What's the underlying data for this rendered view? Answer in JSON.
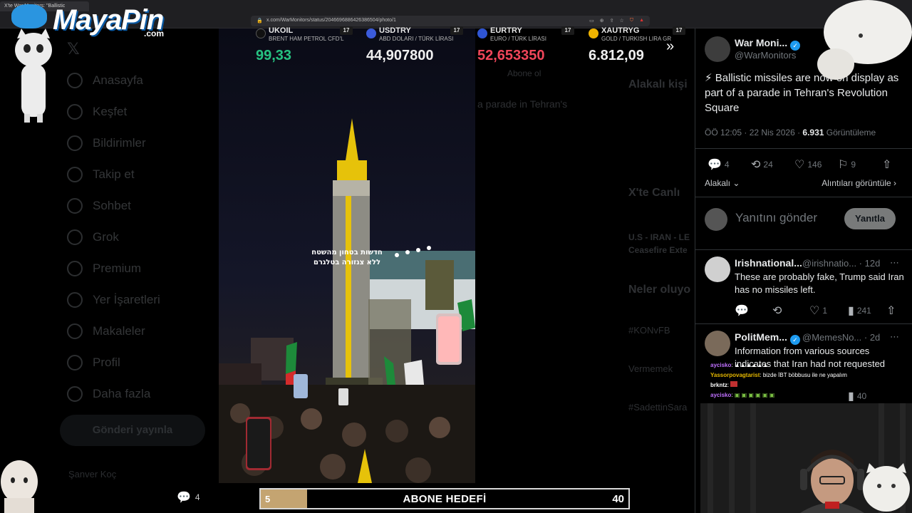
{
  "browser": {
    "tab_title": "X'te War Monitors: \"Ballistic",
    "url": "x.com/WarMonitors/status/2046696886426386504/photo/1"
  },
  "logo": {
    "text": "MayaPin",
    "suffix": ".com"
  },
  "sidebar": {
    "items": [
      {
        "label": "Anasayfa",
        "icon": "home-icon"
      },
      {
        "label": "Keşfet",
        "icon": "search-icon"
      },
      {
        "label": "Bildirimler",
        "icon": "bell-icon"
      },
      {
        "label": "Takip et",
        "icon": "person-plus-icon"
      },
      {
        "label": "Sohbet",
        "icon": "chat-icon"
      },
      {
        "label": "Grok",
        "icon": "grok-icon"
      },
      {
        "label": "Premium",
        "icon": "premium-icon"
      },
      {
        "label": "Yer İşaretleri",
        "icon": "bookmark-icon"
      },
      {
        "label": "Makaleler",
        "icon": "article-icon"
      },
      {
        "label": "Profil",
        "icon": "profile-icon"
      },
      {
        "label": "Daha fazla",
        "icon": "more-icon"
      }
    ],
    "post_button": "Gönderi yayınla",
    "profile_name": "Şanver Koç"
  },
  "background": {
    "subscribe": "Abone ol",
    "related_accounts": "Alakalı kişi",
    "caption": "a parade in Tehran's",
    "live_on_x": "X'te Canlı",
    "live_item": "U.S - IRAN - LE",
    "live_item2": "Ceasefire Exte",
    "whats_happening": "Neler oluyo",
    "trend1": "#KONvFB",
    "trend2": "Vermemek",
    "trend3": "#SadettinSara"
  },
  "ticker": [
    {
      "symbol": "UKOIL",
      "desc": "BRENT HAM PETROL CFD'L",
      "value": "99,33",
      "color": "#26c281",
      "flag_color": "#111111"
    },
    {
      "symbol": "USDTRY",
      "desc": "ABD DOLARI / TÜRK LİRASI",
      "value": "44,907800",
      "color": "#f0f0f0",
      "flag_color": "#3b5bdb"
    },
    {
      "symbol": "EURTRY",
      "desc": "EURO / TÜRK LİRASI",
      "value": "52,653350",
      "color": "#f0465a",
      "flag_color": "#2f55d4"
    },
    {
      "symbol": "XAUTRYG",
      "desc": "GOLD / TURKISH LIRA GR",
      "value": "6.812,09",
      "color": "#f0f0f0",
      "flag_color": "#f0b400"
    }
  ],
  "ticker_badge": "17",
  "photo": {
    "overlay_text_line1": "חדשות בטחון מהשטח",
    "overlay_text_line2": "ללא צנזורה בטלגרם"
  },
  "tweet": {
    "author": "War Moni...",
    "handle": "@WarMonitors",
    "text": "⚡ Ballistic missiles are now on display as part of a parade in Tehran's Revolution Square",
    "time": "ÖÖ 12:05 · 22 Nis 2026 ·",
    "views": "6.931",
    "views_label": "Görüntüleme",
    "replies": "4",
    "retweets": "24",
    "likes": "146",
    "bookmarks": "9",
    "related_label": "Alakalı",
    "quotes_label": "Alıntıları görüntüle"
  },
  "reply_box": {
    "placeholder": "Yanıtını gönder",
    "button": "Yanıtla"
  },
  "replies": [
    {
      "name": "Irishnational...",
      "handle": "@irishnatio... · 12d",
      "text": "These are probably fake, Trump said Iran has no missiles left.",
      "replies": "",
      "retweets": "",
      "likes": "1",
      "views": "241"
    },
    {
      "name": "PolitMem...",
      "handle": "@MemesNo... · 2d",
      "text": "Information from various sources indicates that Iran had not requested",
      "views": "40"
    }
  ],
  "chat": [
    {
      "user": "aycisko",
      "user_color": "#c070ff",
      "message": ": ▲▲▲▲▲▲"
    },
    {
      "user": "Yassorpovagtarist",
      "user_color": "#e6b800",
      "message": ": bizde İBT böbbusu ile ne yapalım"
    },
    {
      "user": "brkntz",
      "user_color": "#ffffff",
      "message": ":"
    },
    {
      "user": "aycisko",
      "user_color": "#c070ff",
      "message": ":"
    }
  ],
  "bottom": {
    "replies": "4",
    "likes": "146",
    "goal_label": "ABONE HEDEFİ",
    "goal_current": "5",
    "goal_target": "40",
    "goal_progress": 0.125
  },
  "colors": {
    "accent": "#1d9bf0",
    "goal": "#c4a471",
    "up": "#26c281",
    "down": "#f0465a"
  }
}
